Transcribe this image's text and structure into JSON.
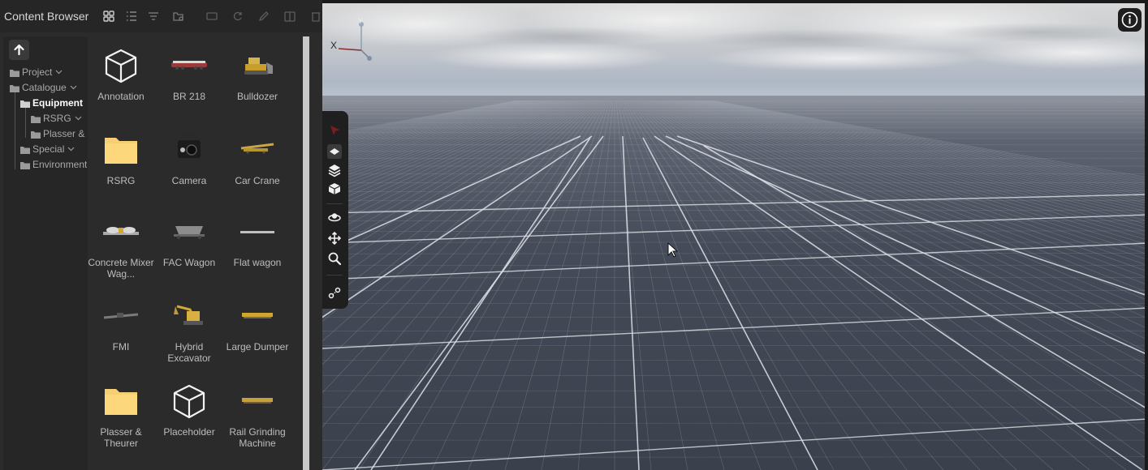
{
  "panel": {
    "title": "Content Browser",
    "toolbar": {
      "grid_icon": "grid-view-icon",
      "list_icon": "list-view-icon",
      "filter_icon": "filter-icon",
      "settings_icon": "folder-settings-icon",
      "tool_icons": [
        "frame-icon",
        "refresh-icon",
        "pencil-icon",
        "export-icon",
        "trash-icon"
      ]
    },
    "up_icon": "arrow-up-icon",
    "tree": [
      {
        "label": "Project",
        "expanded": false
      },
      {
        "label": "Catalogue",
        "expanded": true
      },
      {
        "label": "Equipment",
        "selected": true
      },
      {
        "label": "RSRG",
        "expanded": false
      },
      {
        "label": "Plasser &",
        "expanded": null
      },
      {
        "label": "Special",
        "expanded": false
      },
      {
        "label": "Environment",
        "expanded": null
      }
    ],
    "items": [
      {
        "label": "Annotation",
        "icon": "cube-outline-icon"
      },
      {
        "label": "BR 218",
        "icon": "locomotive-thumbnail"
      },
      {
        "label": "Bulldozer",
        "icon": "bulldozer-thumbnail"
      },
      {
        "label": "RSRG",
        "icon": "folder-icon"
      },
      {
        "label": "Camera",
        "icon": "camera-thumbnail"
      },
      {
        "label": "Car Crane",
        "icon": "car-crane-thumbnail"
      },
      {
        "label": "Concrete Mixer Wag...",
        "icon": "concrete-mixer-thumbnail"
      },
      {
        "label": "FAC Wagon",
        "icon": "fac-wagon-thumbnail"
      },
      {
        "label": "Flat wagon",
        "icon": "flat-wagon-thumbnail"
      },
      {
        "label": "FMI",
        "icon": "fmi-thumbnail"
      },
      {
        "label": "Hybrid Excavator",
        "icon": "excavator-thumbnail"
      },
      {
        "label": "Large Dumper",
        "icon": "dumper-thumbnail"
      },
      {
        "label": "Plasser & Theurer",
        "icon": "folder-icon"
      },
      {
        "label": "Placeholder",
        "icon": "cube-outline-icon"
      },
      {
        "label": "Rail Grinding Machine",
        "icon": "rail-grinder-thumbnail"
      }
    ]
  },
  "viewport": {
    "axis_x": "X",
    "axis_y": "Y",
    "info_icon": "info-icon",
    "toolbar_icons": [
      "select-arrow-icon",
      "layer-single-icon",
      "layers-stack-icon",
      "cube-solid-icon",
      "orbit-icon",
      "move-icon",
      "zoom-icon",
      "measure-icon"
    ],
    "colors": {
      "sky_top": "#c9ccd1",
      "horizon": "#a9b4c4",
      "ground": "#3c4250",
      "grid_major": "#d8dbe0"
    }
  }
}
